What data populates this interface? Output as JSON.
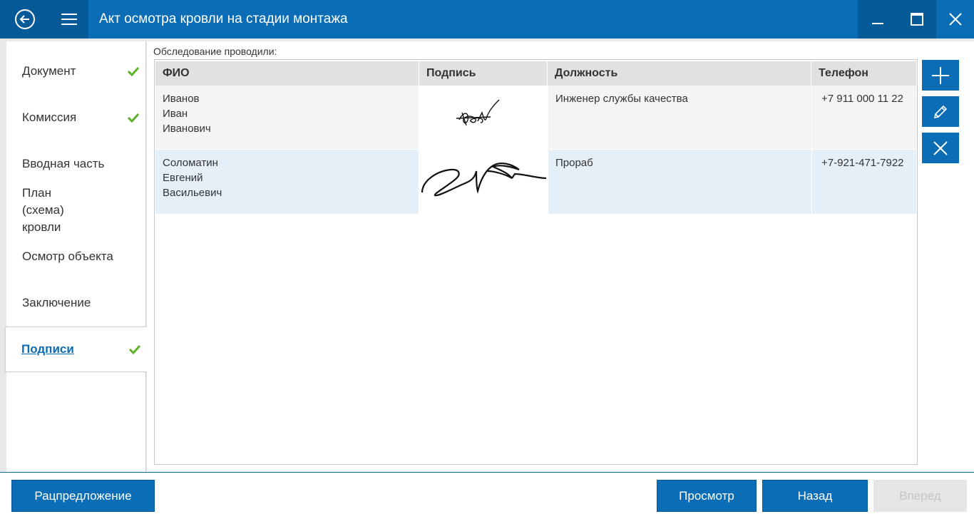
{
  "window": {
    "title": "Акт осмотра кровли на стадии монтажа"
  },
  "sidebar": {
    "items": [
      {
        "label": "Документ",
        "checked": true
      },
      {
        "label": "Комиссия",
        "checked": true
      },
      {
        "label": "Вводная часть",
        "checked": false
      },
      {
        "label": "План (схема) кровли",
        "checked": false
      },
      {
        "label": "Осмотр объекта",
        "checked": false
      },
      {
        "label": "Заключение",
        "checked": false
      },
      {
        "label": "Подписи",
        "checked": true,
        "active": true
      }
    ]
  },
  "main": {
    "caption": "Обследование проводили:",
    "columns": [
      "ФИО",
      "Подпись",
      "Должность",
      "Телефон"
    ],
    "rows": [
      {
        "fio_line1": "Иванов",
        "fio_line2": "Иван",
        "fio_line3": "Иванович",
        "position": "Инженер службы качества",
        "phone": "+7 911 000 11 22"
      },
      {
        "fio_line1": "Соломатин",
        "fio_line2": "Евгений",
        "fio_line3": "Васильевич",
        "position": "Прораб",
        "phone": "+7-921-471-7922"
      }
    ]
  },
  "actions": {
    "add_icon": "plus-icon",
    "edit_icon": "pencil-icon",
    "delete_icon": "close-icon"
  },
  "footer": {
    "proposal": "Рацпредложение",
    "preview": "Просмотр",
    "back": "Назад",
    "forward": "Вперед"
  },
  "colors": {
    "accent": "#0a6db5",
    "accent_dark": "#075a98",
    "check": "#5cb22a",
    "row_alt": "#e5eff8",
    "row_first": "#f4f4f4"
  }
}
